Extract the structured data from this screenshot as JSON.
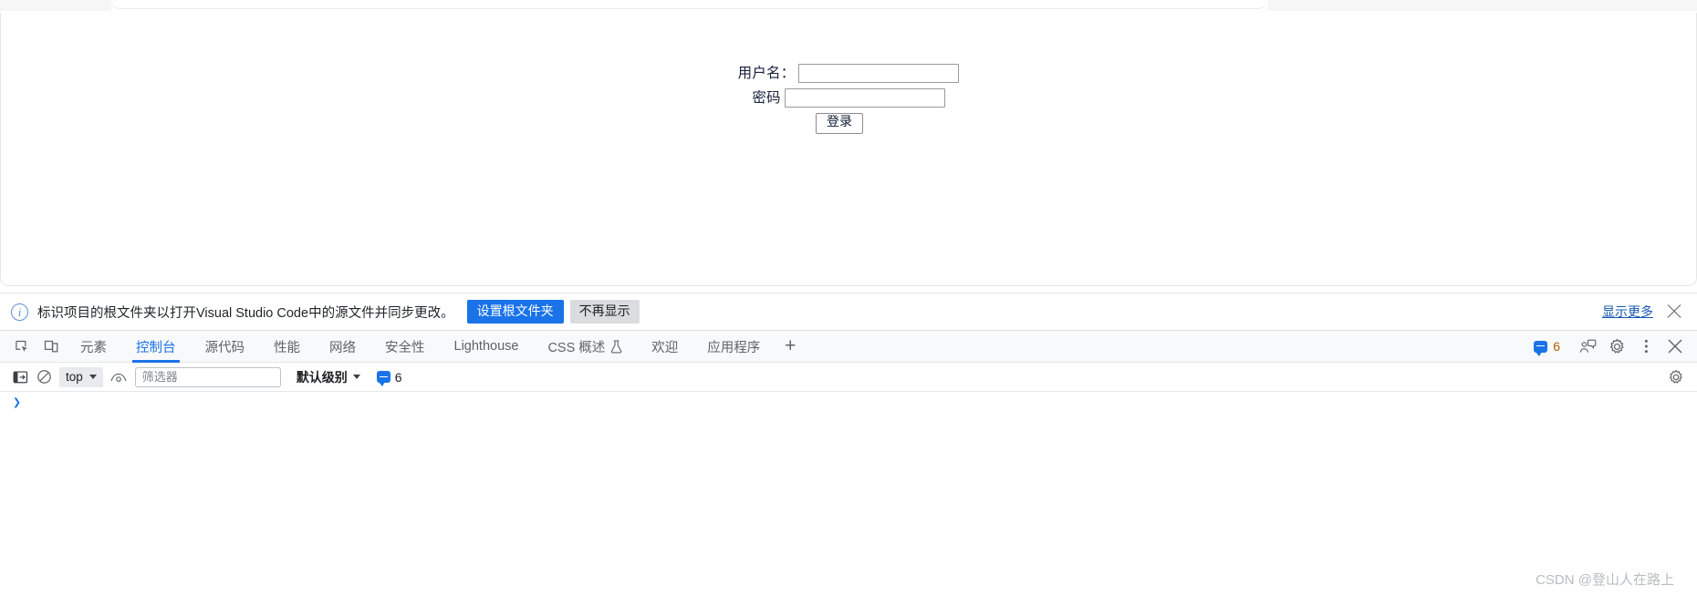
{
  "page": {
    "login_form": {
      "username_label": "用户名：",
      "username_value": "",
      "password_label": "密码",
      "password_value": "",
      "submit_label": "登录"
    }
  },
  "notice_bar": {
    "icon": "info-circle-icon",
    "message": "标识项目的根文件夹以打开Visual Studio Code中的源文件并同步更改。",
    "primary_button": "设置根文件夹",
    "secondary_button": "不再显示",
    "show_more_link": "显示更多",
    "close_icon": "close-icon"
  },
  "devtools": {
    "left_icons": [
      {
        "name": "inspect-element-icon"
      },
      {
        "name": "device-toolbar-icon"
      }
    ],
    "tabs": [
      {
        "label": "元素",
        "active": false
      },
      {
        "label": "控制台",
        "active": true
      },
      {
        "label": "源代码",
        "active": false
      },
      {
        "label": "性能",
        "active": false
      },
      {
        "label": "网络",
        "active": false
      },
      {
        "label": "安全性",
        "active": false
      },
      {
        "label": "Lighthouse",
        "active": false
      },
      {
        "label": "CSS 概述",
        "active": false,
        "icon": "beaker-icon"
      },
      {
        "label": "欢迎",
        "active": false
      },
      {
        "label": "应用程序",
        "active": false
      }
    ],
    "add_tab_label": "+",
    "issues_count": "6",
    "right_icons": [
      {
        "name": "feedback-icon"
      },
      {
        "name": "settings-gear-icon"
      },
      {
        "name": "more-options-icon"
      },
      {
        "name": "close-devtools-icon"
      }
    ]
  },
  "console_toolbar": {
    "sidebar_toggle_icon": "console-sidebar-icon",
    "clear_console_icon": "clear-console-icon",
    "context_label": "top",
    "live_expression_icon": "eye-icon",
    "filter_placeholder": "筛选器",
    "filter_value": "",
    "level_label": "默认级别",
    "issues_count": "6",
    "settings_icon": "console-settings-gear-icon"
  },
  "console": {
    "prompt_caret": "❯",
    "input_value": ""
  },
  "watermark": {
    "text": "CSDN @登山人在路上"
  },
  "colors": {
    "accent_blue": "#1a73e8",
    "link_blue": "#1558b0",
    "warning_orange": "#b06000",
    "toolbar_bg": "#f8f9fa",
    "secondary_btn": "#dadce0"
  }
}
